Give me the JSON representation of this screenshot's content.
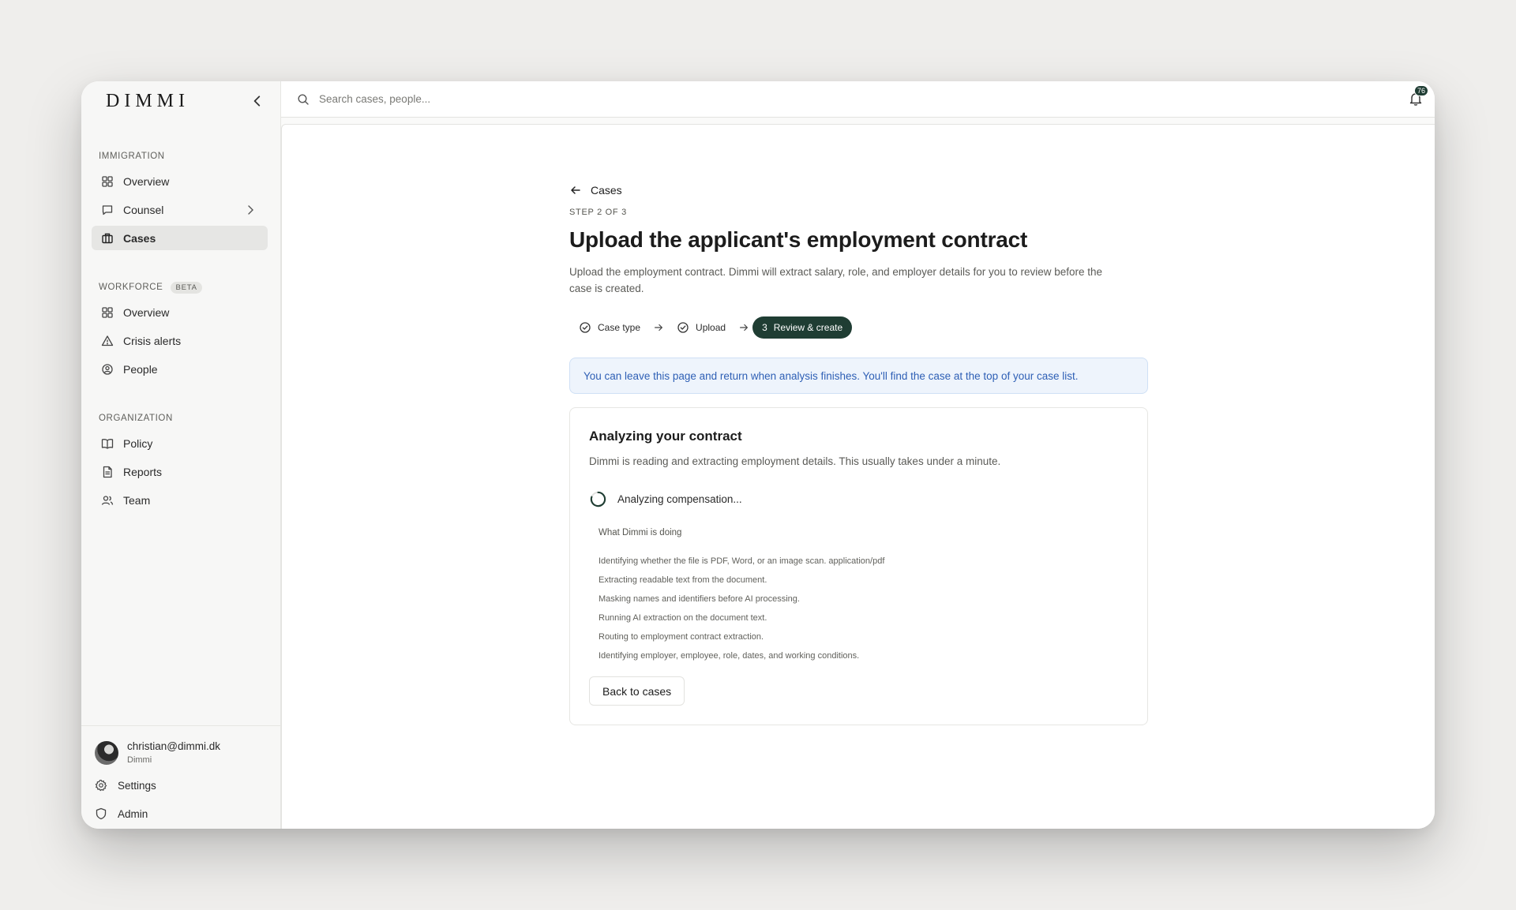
{
  "app": {
    "logo": "DIMMI"
  },
  "search": {
    "placeholder": "Search cases, people..."
  },
  "notifications": {
    "count": "76"
  },
  "sidebar": {
    "sections": [
      {
        "label": "IMMIGRATION",
        "items": [
          {
            "label": "Overview",
            "icon": "grid-icon"
          },
          {
            "label": "Counsel",
            "icon": "chat-icon",
            "has_submenu": true
          },
          {
            "label": "Cases",
            "icon": "briefcase-icon",
            "active": true
          }
        ]
      },
      {
        "label": "WORKFORCE",
        "badge": "BETA",
        "items": [
          {
            "label": "Overview",
            "icon": "grid-icon"
          },
          {
            "label": "Crisis alerts",
            "icon": "warning-icon"
          },
          {
            "label": "People",
            "icon": "user-circle-icon"
          }
        ]
      },
      {
        "label": "ORGANIZATION",
        "items": [
          {
            "label": "Policy",
            "icon": "book-icon"
          },
          {
            "label": "Reports",
            "icon": "document-icon"
          },
          {
            "label": "Team",
            "icon": "users-icon"
          }
        ]
      }
    ],
    "user": {
      "email": "christian@dimmi.dk",
      "org": "Dimmi"
    },
    "footer": {
      "settings": "Settings",
      "admin": "Admin"
    }
  },
  "page": {
    "back_label": "Cases",
    "step_label": "STEP 2 OF 3",
    "title": "Upload the applicant's employment contract",
    "subtitle": "Upload the employment contract. Dimmi will extract salary, role, and employer details for you to review before the case is created.",
    "steps": [
      {
        "label": "Case type",
        "state": "done"
      },
      {
        "label": "Upload",
        "state": "done"
      },
      {
        "number": "3",
        "label": "Review & create",
        "state": "current"
      }
    ],
    "info": "You can leave this page and return when analysis finishes. You'll find the case at the top of your case list.",
    "card": {
      "title": "Analyzing your contract",
      "description": "Dimmi is reading and extracting employment details. This usually takes under a minute.",
      "status": "Analyzing compensation...",
      "doing_title": "What Dimmi is doing",
      "doing_items": [
        "Identifying whether the file is PDF, Word, or an image scan. application/pdf",
        "Extracting readable text from the document.",
        "Masking names and identifiers before AI processing.",
        "Running AI extraction on the document text.",
        "Routing to employment contract extraction.",
        "Identifying employer, employee, role, dates, and working conditions."
      ],
      "back_button": "Back to cases"
    }
  },
  "colors": {
    "accent": "#1f3d33",
    "info_bg": "#eef4fc",
    "info_text": "#2e5fb5",
    "active_nav": "#e6e6e4"
  }
}
